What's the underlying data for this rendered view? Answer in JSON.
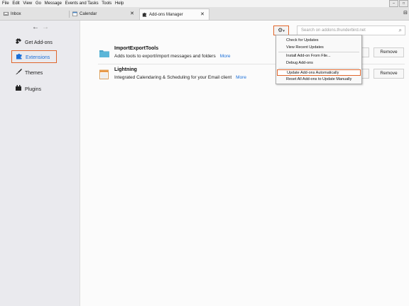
{
  "menubar": {
    "items": [
      "File",
      "Edit",
      "View",
      "Go",
      "Message",
      "Events and Tasks",
      "Tools",
      "Help"
    ]
  },
  "tabs": [
    {
      "label": "Inbox"
    },
    {
      "label": "Calendar"
    },
    {
      "label": "Add-ons Manager"
    }
  ],
  "sidebar": {
    "categories": [
      {
        "label": "Get Add-ons",
        "icon": "puzzle-download-icon"
      },
      {
        "label": "Extensions",
        "icon": "puzzle-icon",
        "selected": true
      },
      {
        "label": "Themes",
        "icon": "brush-icon"
      },
      {
        "label": "Plugins",
        "icon": "plugin-block-icon"
      }
    ]
  },
  "search": {
    "placeholder": "Search on addons.thunderbird.net"
  },
  "addons": [
    {
      "name": "ImportExportTools",
      "description": "Adds tools to export/import messages and folders",
      "more": "More",
      "remove": "Remove"
    },
    {
      "name": "Lightning",
      "description": "Integrated Calendaring & Scheduling for your Email client",
      "more": "More",
      "remove": "Remove"
    }
  ],
  "tools_menu": {
    "items": [
      {
        "label": "Check for Updates"
      },
      {
        "label": "View Recent Updates"
      },
      {
        "label": "Install Add-on From File..."
      },
      {
        "label": "Debug Add-ons"
      },
      {
        "label": "Update Add-ons Automatically",
        "highlighted": true
      },
      {
        "label": "Reset All Add-ons to Update Manually"
      }
    ]
  },
  "colors": {
    "accent": "#e0652a",
    "link": "#1b6fd8"
  }
}
